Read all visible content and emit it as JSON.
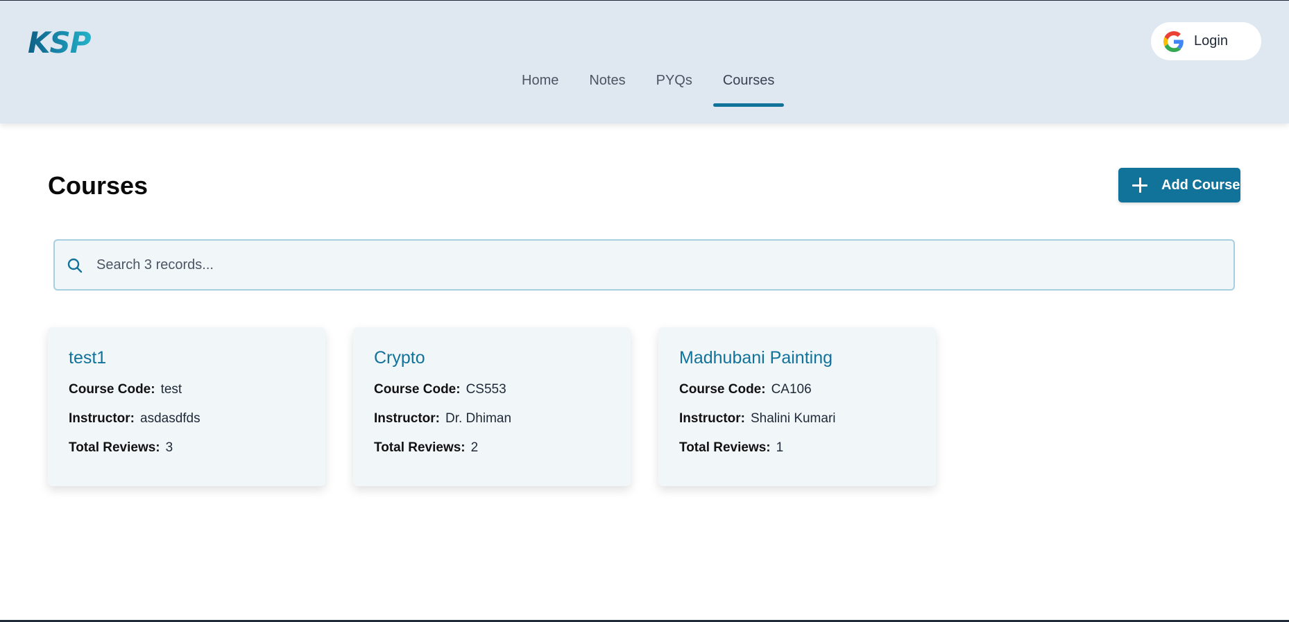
{
  "header": {
    "logo": "KSP",
    "nav": [
      {
        "label": "Home",
        "active": false
      },
      {
        "label": "Notes",
        "active": false
      },
      {
        "label": "PYQs",
        "active": false
      },
      {
        "label": "Courses",
        "active": true
      }
    ],
    "login_label": "Login",
    "login_icon": "google-icon"
  },
  "main": {
    "title": "Courses",
    "add_button_label": "Add Course",
    "add_button_icon": "plus-icon",
    "search": {
      "placeholder": "Search 3 records...",
      "value": "",
      "icon": "search-icon"
    },
    "field_labels": {
      "code": "Course Code:",
      "instructor": "Instructor:",
      "reviews": "Total Reviews:"
    },
    "courses": [
      {
        "name": "test1",
        "code": "test",
        "instructor": "asdasdfds",
        "reviews": "3"
      },
      {
        "name": "Crypto",
        "code": "CS553",
        "instructor": "Dr. Dhiman",
        "reviews": "2"
      },
      {
        "name": "Madhubani Painting",
        "code": "CA106",
        "instructor": "Shalini Kumari",
        "reviews": "1"
      }
    ]
  },
  "colors": {
    "header_bg": "#dfe8f0",
    "accent": "#11729a",
    "card_bg": "#f1f6f9",
    "search_border": "#a8cfdf"
  }
}
